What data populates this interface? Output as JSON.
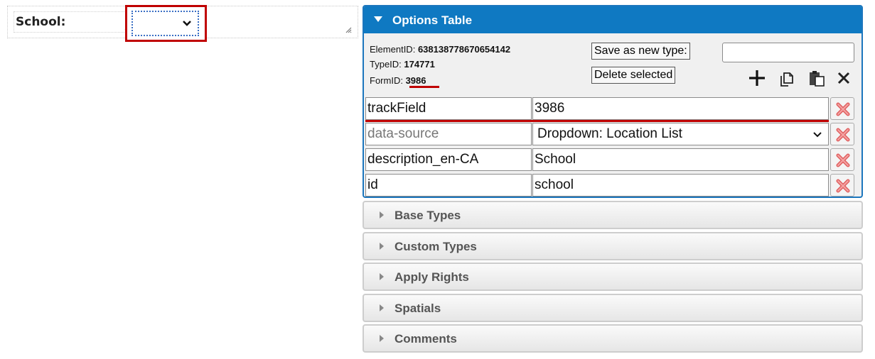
{
  "form": {
    "field_label": "School:",
    "select_value": ""
  },
  "options_table": {
    "title": "Options Table",
    "element_id_label": "ElementID:",
    "element_id": "638138778670654142",
    "type_id_label": "TypeID:",
    "type_id": "174771",
    "form_id_label": "FormID:",
    "form_id": "3986",
    "save_as_new_type_label": "Save as new type:",
    "new_type_value": "",
    "delete_selected_label": "Delete selected",
    "toolbar_icons": [
      "plus-icon",
      "copy-icon",
      "paste-icon",
      "close-icon"
    ],
    "rows": [
      {
        "key": "trackField",
        "value": "3986",
        "type": "text"
      },
      {
        "key": "data-source",
        "value": "Dropdown: Location List",
        "type": "select",
        "key_muted": true
      },
      {
        "key": "description_en-CA",
        "value": "School",
        "type": "text"
      },
      {
        "key": "id",
        "value": "school",
        "type": "text"
      }
    ]
  },
  "accordion": [
    {
      "label": "Base Types"
    },
    {
      "label": "Custom Types"
    },
    {
      "label": "Apply Rights"
    },
    {
      "label": "Spatials"
    },
    {
      "label": "Comments"
    }
  ],
  "colors": {
    "accent": "#0f79c2",
    "highlight_red": "#c00000",
    "delete_x": "#e05555"
  }
}
